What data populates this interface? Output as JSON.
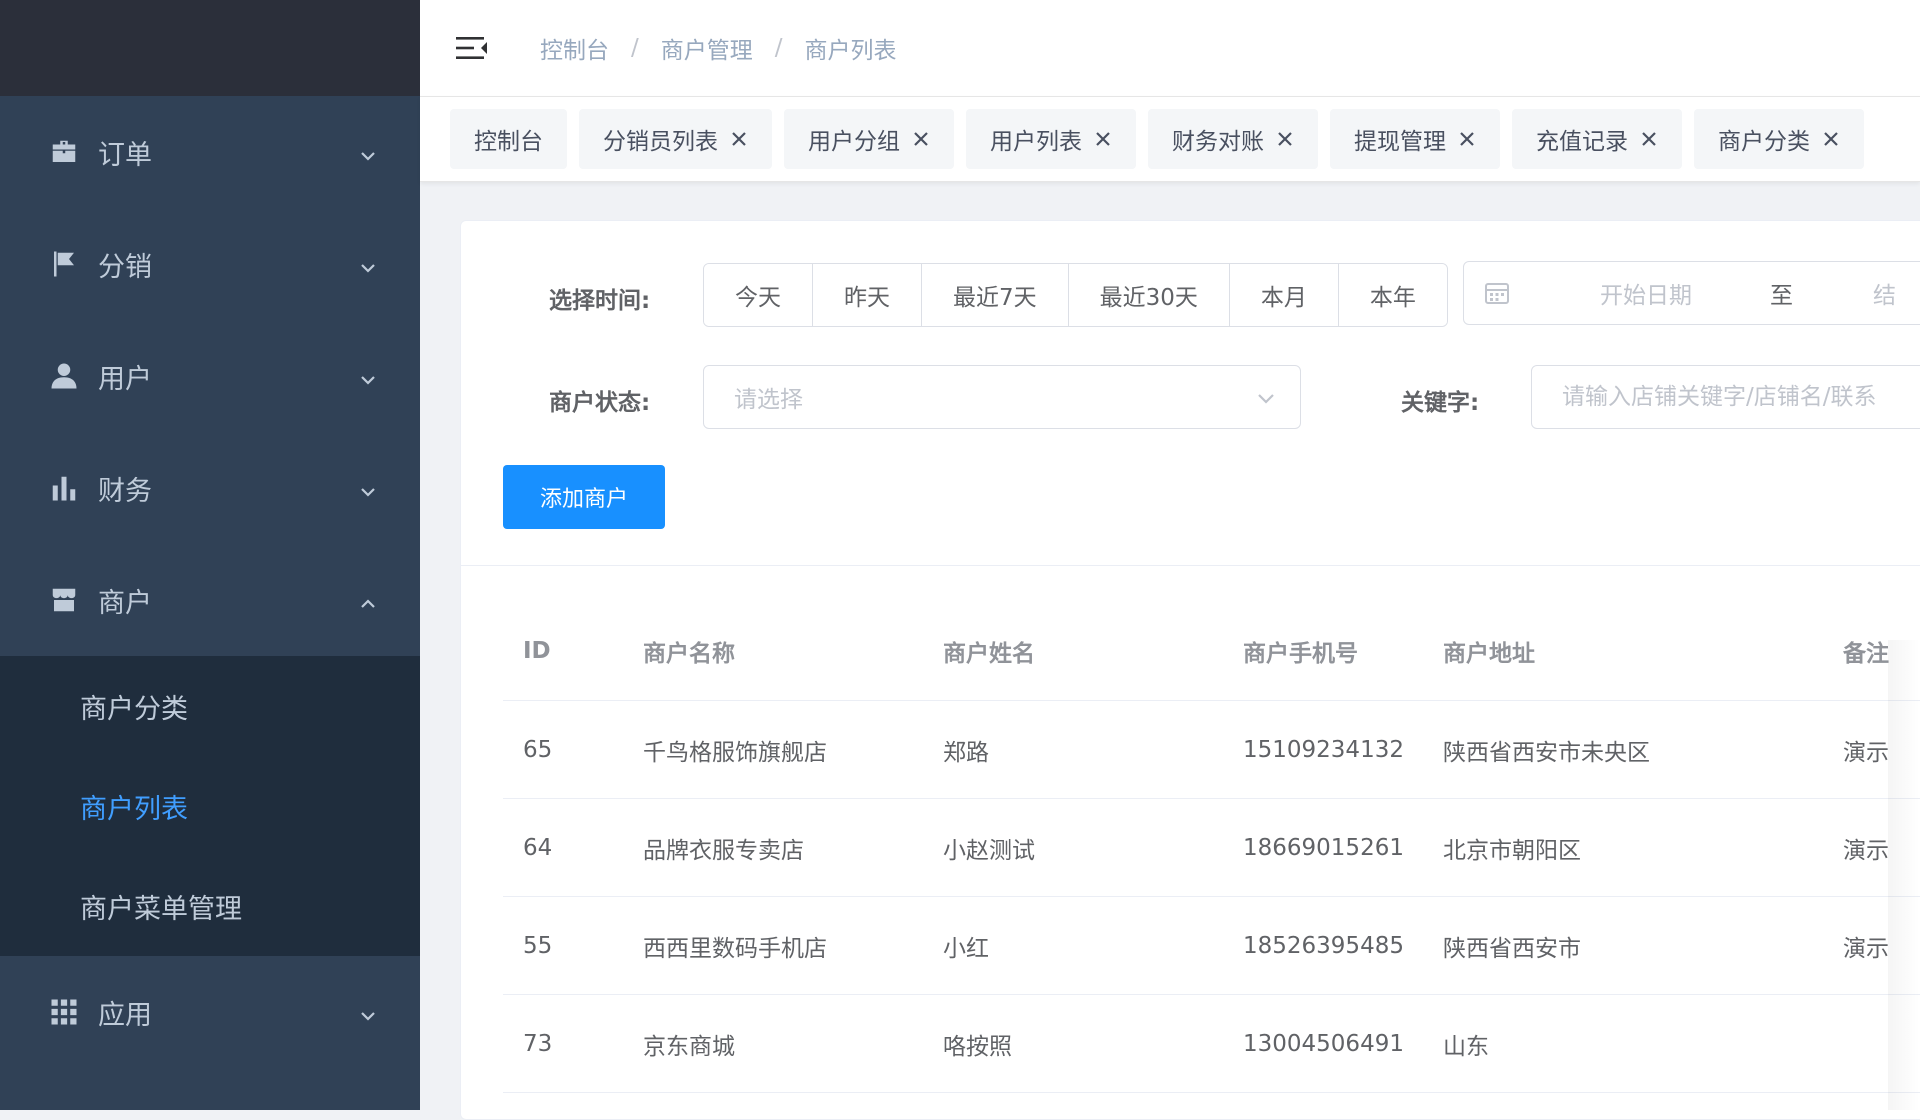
{
  "sidebar": {
    "menus": [
      {
        "label": "订单",
        "icon": "briefcase-icon",
        "expanded": false
      },
      {
        "label": "分销",
        "icon": "flag-icon",
        "expanded": false
      },
      {
        "label": "用户",
        "icon": "user-icon",
        "expanded": false
      },
      {
        "label": "财务",
        "icon": "bar-chart-icon",
        "expanded": false
      },
      {
        "label": "商户",
        "icon": "store-icon",
        "expanded": true,
        "children": [
          {
            "label": "商户分类",
            "active": false
          },
          {
            "label": "商户列表",
            "active": true
          },
          {
            "label": "商户菜单管理",
            "active": false
          }
        ]
      },
      {
        "label": "应用",
        "icon": "grid-icon",
        "expanded": false
      }
    ]
  },
  "header": {
    "breadcrumb": [
      "控制台",
      "商户管理",
      "商户列表"
    ],
    "separator": "/"
  },
  "tags": [
    {
      "label": "控制台",
      "closable": false
    },
    {
      "label": "分销员列表",
      "closable": true
    },
    {
      "label": "用户分组",
      "closable": true
    },
    {
      "label": "用户列表",
      "closable": true
    },
    {
      "label": "财务对账",
      "closable": true
    },
    {
      "label": "提现管理",
      "closable": true
    },
    {
      "label": "充值记录",
      "closable": true
    },
    {
      "label": "商户分类",
      "closable": true
    }
  ],
  "filters": {
    "time_label": "选择时间:",
    "time_buttons": [
      "今天",
      "昨天",
      "最近7天",
      "最近30天",
      "本月",
      "本年"
    ],
    "date_start_placeholder": "开始日期",
    "date_separator": "至",
    "date_end_placeholder": "结",
    "status_label": "商户状态:",
    "status_placeholder": "请选择",
    "keyword_label": "关键字:",
    "keyword_placeholder": "请输入店铺关键字/店铺名/联系"
  },
  "actions": {
    "add_label": "添加商户"
  },
  "table": {
    "columns": [
      "ID",
      "商户名称",
      "商户姓名",
      "商户手机号",
      "商户地址",
      "备注"
    ],
    "rows": [
      {
        "id": "65",
        "name": "千鸟格服饰旗舰店",
        "person": "郑路",
        "phone": "15109234132",
        "address": "陕西省西安市未央区",
        "note": "演示"
      },
      {
        "id": "64",
        "name": "品牌衣服专卖店",
        "person": "小赵测试",
        "phone": "18669015261",
        "address": "北京市朝阳区",
        "note": "演示"
      },
      {
        "id": "55",
        "name": "西西里数码手机店",
        "person": "小红",
        "phone": "18526395485",
        "address": "陕西省西安市",
        "note": "演示"
      },
      {
        "id": "73",
        "name": "京东商城",
        "person": "咯按照",
        "phone": "13004506491",
        "address": "山东",
        "note": ""
      }
    ]
  },
  "colors": {
    "sidebar_bg": "#304156",
    "submenu_bg": "#1f2d3d",
    "active": "#409eff",
    "primary_button": "#1890ff"
  }
}
